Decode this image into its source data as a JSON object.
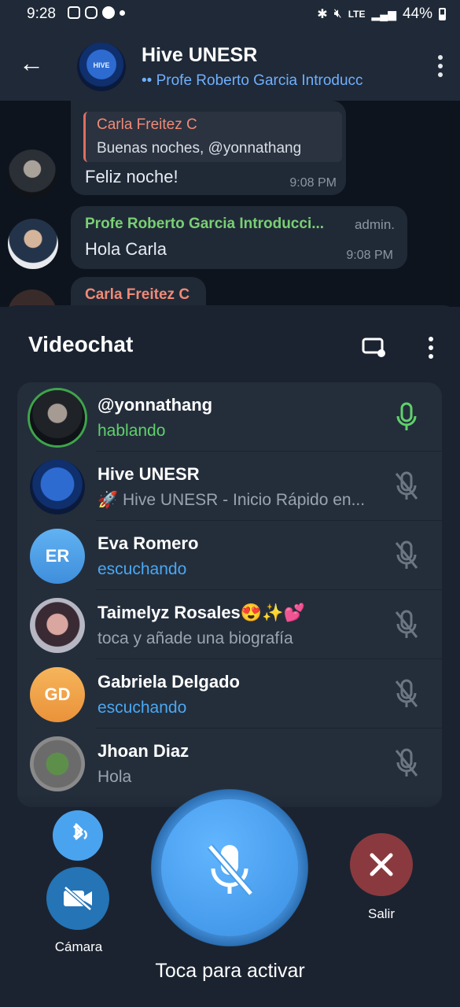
{
  "status_bar": {
    "time": "9:28",
    "battery": "44%",
    "network": "LTE"
  },
  "header": {
    "title": "Hive UNESR",
    "subtitle": "Profe Roberto Garcia Introducc",
    "avatar_text": "HIVE"
  },
  "chat": {
    "message1": {
      "reply_name": "Carla Freitez C",
      "reply_text": "Buenas noches, @yonnathang",
      "text": "Feliz noche!",
      "time": "9:08 PM"
    },
    "message2": {
      "sender": "Profe Roberto Garcia Introducci...",
      "role": "admin.",
      "text": "Hola Carla",
      "time": "9:08 PM"
    },
    "message3": {
      "sender": "Carla Freitez C"
    }
  },
  "videochat": {
    "title": "Videochat",
    "participants": [
      {
        "name": "@yonnathang",
        "status": "hablando",
        "status_color": "#5fd16a",
        "mic": "active"
      },
      {
        "name": "Hive UNESR",
        "status": "🚀 Hive UNESR - Inicio Rápido en...",
        "status_color": "#9aa4b1",
        "mic": "muted"
      },
      {
        "name": "Eva Romero",
        "initials": "ER",
        "avatar_color": "#4a9fe8",
        "status": "escuchando",
        "status_color": "#4aa8f2",
        "mic": "muted"
      },
      {
        "name": "Taimelyz Rosales😍✨💕",
        "status": "toca y añade una biografía",
        "status_color": "#9aa4b1",
        "mic": "muted"
      },
      {
        "name": "Gabriela Delgado",
        "initials": "GD",
        "avatar_color": "#f0a24a",
        "status": "escuchando",
        "status_color": "#4aa8f2",
        "mic": "muted"
      },
      {
        "name": "Jhoan Diaz",
        "status": "Hola",
        "status_color": "#9aa4b1",
        "mic": "muted"
      }
    ],
    "controls": {
      "camera_label": "Cámara",
      "leave_label": "Salir",
      "tap_label": "Toca para activar"
    }
  },
  "colors": {
    "accent": "#3a8fe3",
    "leave": "#8a3a3e",
    "speaking": "#5fd16a"
  }
}
